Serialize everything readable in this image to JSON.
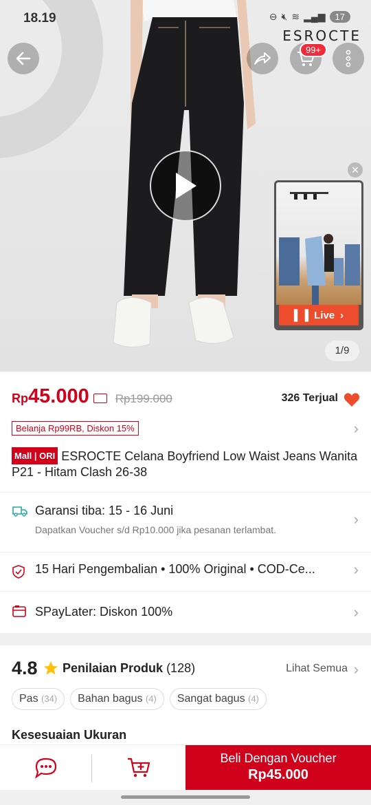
{
  "status_bar": {
    "time": "18.19",
    "battery": "17"
  },
  "brand": {
    "logo_text": "ESROCTE"
  },
  "header": {
    "cart_badge": "99+"
  },
  "media": {
    "counter": "1/9",
    "live_label": "Live"
  },
  "price": {
    "currency": "Rp",
    "current": "45.000",
    "original": "Rp199.000",
    "sold": "326 Terjual"
  },
  "promo": {
    "tag": "Belanja Rp99RB, Diskon 15%"
  },
  "product": {
    "badge_mall": "Mall",
    "badge_ori": "ORI",
    "title": "ESROCTE Celana Boyfriend Low Waist Jeans Wanita P21 - Hitam Clash 26-38"
  },
  "shipping": {
    "title": "Garansi tiba: 15 - 16 Juni",
    "subtitle": "Dapatkan Voucher s/d Rp10.000 jika pesanan terlambat."
  },
  "guarantee": {
    "text": "15 Hari Pengembalian  •  100% Original  •  COD-Ce..."
  },
  "paylater": {
    "text": "SPayLater: Diskon 100%"
  },
  "reviews": {
    "rating": "4.8",
    "label": "Penilaian Produk",
    "count": "(128)",
    "see_all": "Lihat Semua",
    "chips": [
      {
        "label": "Pas",
        "count": "(34)"
      },
      {
        "label": "Bahan bagus",
        "count": "(4)"
      },
      {
        "label": "Sangat bagus",
        "count": "(4)"
      }
    ],
    "fit_title": "Kesesuaian Ukuran"
  },
  "bottom_bar": {
    "buy_line1": "Beli Dengan Voucher",
    "buy_line2": "Rp45.000"
  },
  "colors": {
    "accent": "#d0011b",
    "live": "#ee4d2d",
    "heart": "#ee4d2d"
  }
}
